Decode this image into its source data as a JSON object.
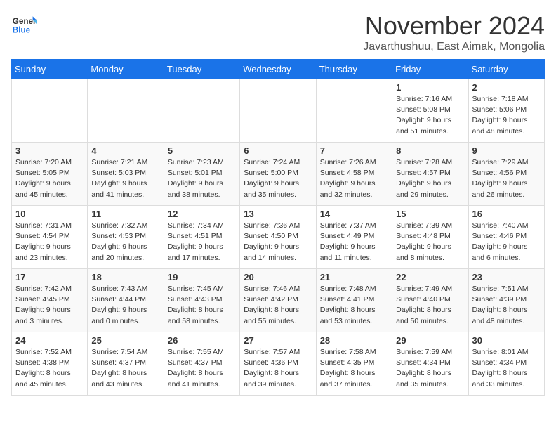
{
  "logo": {
    "line1": "General",
    "line2": "Blue"
  },
  "header": {
    "month": "November 2024",
    "location": "Javarthushuu, East Aimak, Mongolia"
  },
  "days_of_week": [
    "Sunday",
    "Monday",
    "Tuesday",
    "Wednesday",
    "Thursday",
    "Friday",
    "Saturday"
  ],
  "weeks": [
    [
      {
        "day": "",
        "info": ""
      },
      {
        "day": "",
        "info": ""
      },
      {
        "day": "",
        "info": ""
      },
      {
        "day": "",
        "info": ""
      },
      {
        "day": "",
        "info": ""
      },
      {
        "day": "1",
        "info": "Sunrise: 7:16 AM\nSunset: 5:08 PM\nDaylight: 9 hours and 51 minutes."
      },
      {
        "day": "2",
        "info": "Sunrise: 7:18 AM\nSunset: 5:06 PM\nDaylight: 9 hours and 48 minutes."
      }
    ],
    [
      {
        "day": "3",
        "info": "Sunrise: 7:20 AM\nSunset: 5:05 PM\nDaylight: 9 hours and 45 minutes."
      },
      {
        "day": "4",
        "info": "Sunrise: 7:21 AM\nSunset: 5:03 PM\nDaylight: 9 hours and 41 minutes."
      },
      {
        "day": "5",
        "info": "Sunrise: 7:23 AM\nSunset: 5:01 PM\nDaylight: 9 hours and 38 minutes."
      },
      {
        "day": "6",
        "info": "Sunrise: 7:24 AM\nSunset: 5:00 PM\nDaylight: 9 hours and 35 minutes."
      },
      {
        "day": "7",
        "info": "Sunrise: 7:26 AM\nSunset: 4:58 PM\nDaylight: 9 hours and 32 minutes."
      },
      {
        "day": "8",
        "info": "Sunrise: 7:28 AM\nSunset: 4:57 PM\nDaylight: 9 hours and 29 minutes."
      },
      {
        "day": "9",
        "info": "Sunrise: 7:29 AM\nSunset: 4:56 PM\nDaylight: 9 hours and 26 minutes."
      }
    ],
    [
      {
        "day": "10",
        "info": "Sunrise: 7:31 AM\nSunset: 4:54 PM\nDaylight: 9 hours and 23 minutes."
      },
      {
        "day": "11",
        "info": "Sunrise: 7:32 AM\nSunset: 4:53 PM\nDaylight: 9 hours and 20 minutes."
      },
      {
        "day": "12",
        "info": "Sunrise: 7:34 AM\nSunset: 4:51 PM\nDaylight: 9 hours and 17 minutes."
      },
      {
        "day": "13",
        "info": "Sunrise: 7:36 AM\nSunset: 4:50 PM\nDaylight: 9 hours and 14 minutes."
      },
      {
        "day": "14",
        "info": "Sunrise: 7:37 AM\nSunset: 4:49 PM\nDaylight: 9 hours and 11 minutes."
      },
      {
        "day": "15",
        "info": "Sunrise: 7:39 AM\nSunset: 4:48 PM\nDaylight: 9 hours and 8 minutes."
      },
      {
        "day": "16",
        "info": "Sunrise: 7:40 AM\nSunset: 4:46 PM\nDaylight: 9 hours and 6 minutes."
      }
    ],
    [
      {
        "day": "17",
        "info": "Sunrise: 7:42 AM\nSunset: 4:45 PM\nDaylight: 9 hours and 3 minutes."
      },
      {
        "day": "18",
        "info": "Sunrise: 7:43 AM\nSunset: 4:44 PM\nDaylight: 9 hours and 0 minutes."
      },
      {
        "day": "19",
        "info": "Sunrise: 7:45 AM\nSunset: 4:43 PM\nDaylight: 8 hours and 58 minutes."
      },
      {
        "day": "20",
        "info": "Sunrise: 7:46 AM\nSunset: 4:42 PM\nDaylight: 8 hours and 55 minutes."
      },
      {
        "day": "21",
        "info": "Sunrise: 7:48 AM\nSunset: 4:41 PM\nDaylight: 8 hours and 53 minutes."
      },
      {
        "day": "22",
        "info": "Sunrise: 7:49 AM\nSunset: 4:40 PM\nDaylight: 8 hours and 50 minutes."
      },
      {
        "day": "23",
        "info": "Sunrise: 7:51 AM\nSunset: 4:39 PM\nDaylight: 8 hours and 48 minutes."
      }
    ],
    [
      {
        "day": "24",
        "info": "Sunrise: 7:52 AM\nSunset: 4:38 PM\nDaylight: 8 hours and 45 minutes."
      },
      {
        "day": "25",
        "info": "Sunrise: 7:54 AM\nSunset: 4:37 PM\nDaylight: 8 hours and 43 minutes."
      },
      {
        "day": "26",
        "info": "Sunrise: 7:55 AM\nSunset: 4:37 PM\nDaylight: 8 hours and 41 minutes."
      },
      {
        "day": "27",
        "info": "Sunrise: 7:57 AM\nSunset: 4:36 PM\nDaylight: 8 hours and 39 minutes."
      },
      {
        "day": "28",
        "info": "Sunrise: 7:58 AM\nSunset: 4:35 PM\nDaylight: 8 hours and 37 minutes."
      },
      {
        "day": "29",
        "info": "Sunrise: 7:59 AM\nSunset: 4:34 PM\nDaylight: 8 hours and 35 minutes."
      },
      {
        "day": "30",
        "info": "Sunrise: 8:01 AM\nSunset: 4:34 PM\nDaylight: 8 hours and 33 minutes."
      }
    ]
  ]
}
